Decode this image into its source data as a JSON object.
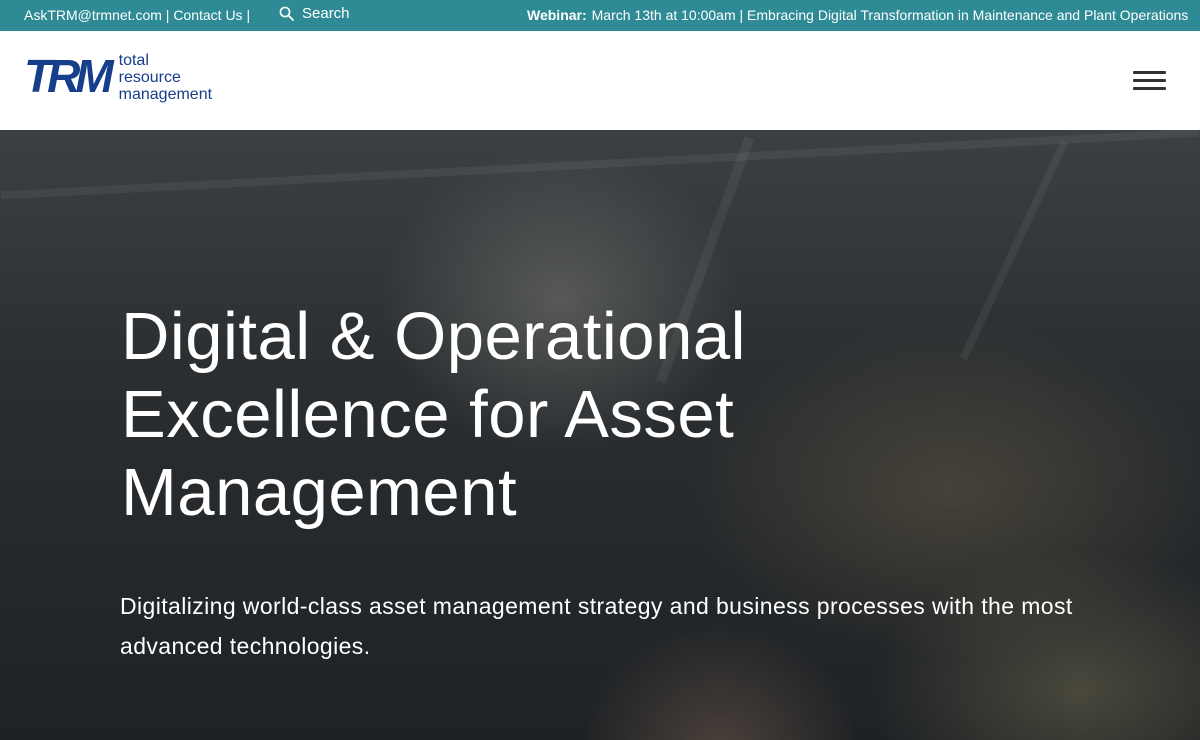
{
  "topbar": {
    "email": "AskTRM@trmnet.com",
    "sep1": " | ",
    "contact": "Contact Us",
    "sep2": " |",
    "search_label": "Search",
    "webinar_label": "Webinar:",
    "webinar_text": "March 13th at 10:00am  | Embracing Digital Transformation in Maintenance and Plant Operations"
  },
  "header": {
    "logo_mark": "TRM",
    "logo_line1": "total",
    "logo_line2": "resource",
    "logo_line3": "management",
    "menu_icon": "hamburger-menu-icon"
  },
  "hero": {
    "title": "Digital & Operational Excellence for Asset Management",
    "subtitle": "Digitalizing world-class asset management strategy and business processes with the most advanced technologies."
  },
  "colors": {
    "topbar_bg": "#2e8b95",
    "brand_blue": "#173e8a",
    "hero_text": "#ffffff"
  }
}
